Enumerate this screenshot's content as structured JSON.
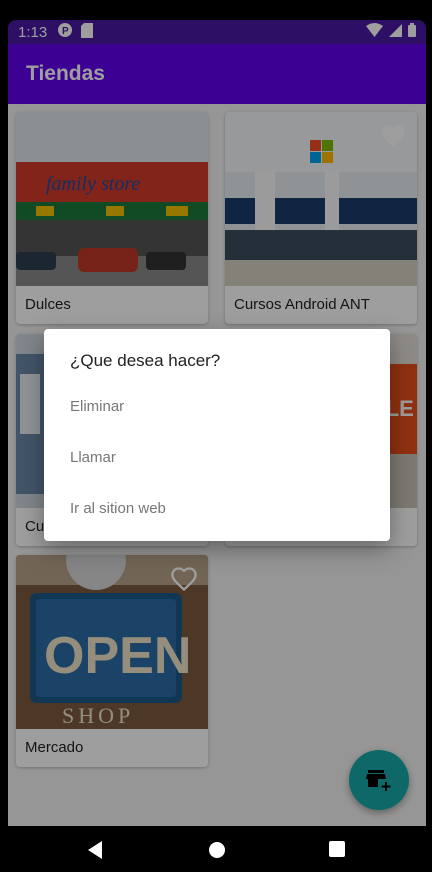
{
  "status_bar": {
    "time": "1:13"
  },
  "app_bar": {
    "title": "Tiendas"
  },
  "stores": [
    {
      "name": "Dulces",
      "favorite": false,
      "image": "family-store-photo"
    },
    {
      "name": "Cursos Android ANT",
      "favorite": true,
      "image": "microsoft-store-photo"
    },
    {
      "name": "Cu",
      "favorite": false,
      "image": "store-photo"
    },
    {
      "name": "",
      "favorite": false,
      "image": "apple-store-photo"
    },
    {
      "name": "Mercado",
      "favorite": false,
      "image": "open-shop-sign-photo"
    }
  ],
  "dialog": {
    "title": "¿Que desea hacer?",
    "options": [
      "Eliminar",
      "Llamar",
      "Ir al sition web"
    ]
  },
  "fab": {
    "icon": "add-store-icon"
  },
  "colors": {
    "primary": "#6200ee",
    "primary_dark": "#4a1aa3",
    "accent": "#18a8a8"
  }
}
